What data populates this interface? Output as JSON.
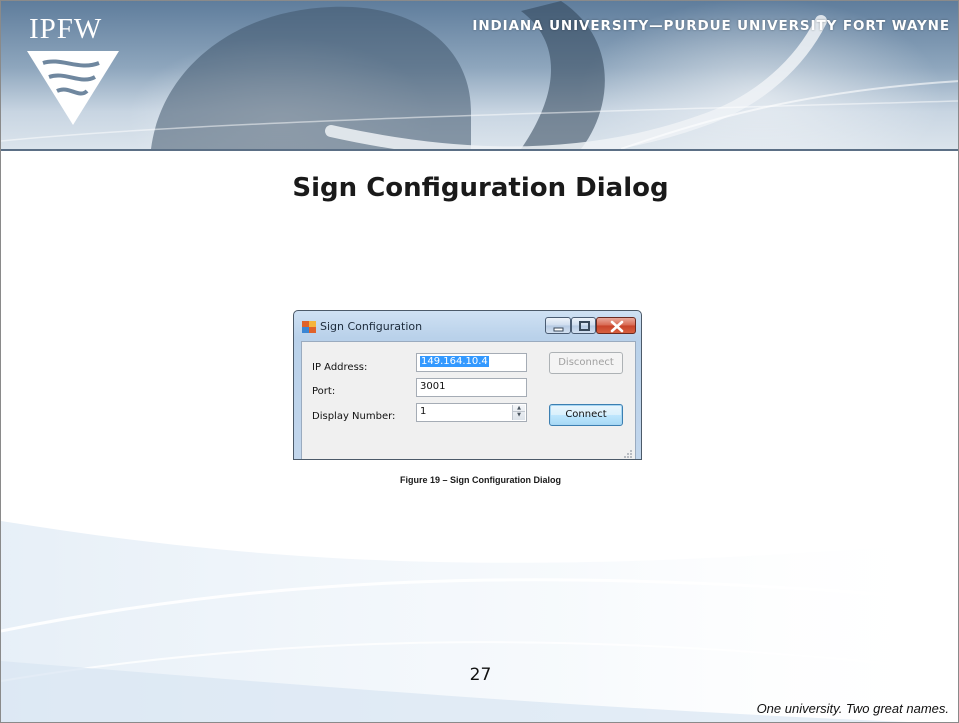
{
  "header": {
    "logo_text": "IPFW",
    "university_name": "INDIANA UNIVERSITY—PURDUE UNIVERSITY FORT WAYNE"
  },
  "slide": {
    "title": "Sign Configuration Dialog",
    "figure_caption": "Figure 19 – Sign Configuration Dialog",
    "page_number": "27",
    "tagline": "One university.  Two great names."
  },
  "dialog": {
    "title": "Sign Configuration",
    "ip_label": "IP Address:",
    "ip_value": "149.164.10.4",
    "port_label": "Port:",
    "port_value": "3001",
    "display_label": "Display Number:",
    "display_value": "1",
    "disconnect_label": "Disconnect",
    "connect_label": "Connect"
  },
  "colors": {
    "header_blue": "#8ea6bd",
    "selection_blue": "#3399ff",
    "close_red": "#c7432a"
  },
  "icons": {
    "app": "app-window-icon",
    "minimize": "minimize-icon",
    "maximize": "maximize-icon",
    "close": "close-icon",
    "spin_up": "chevron-up-icon",
    "spin_down": "chevron-down-icon",
    "grip": "resize-grip-icon"
  }
}
